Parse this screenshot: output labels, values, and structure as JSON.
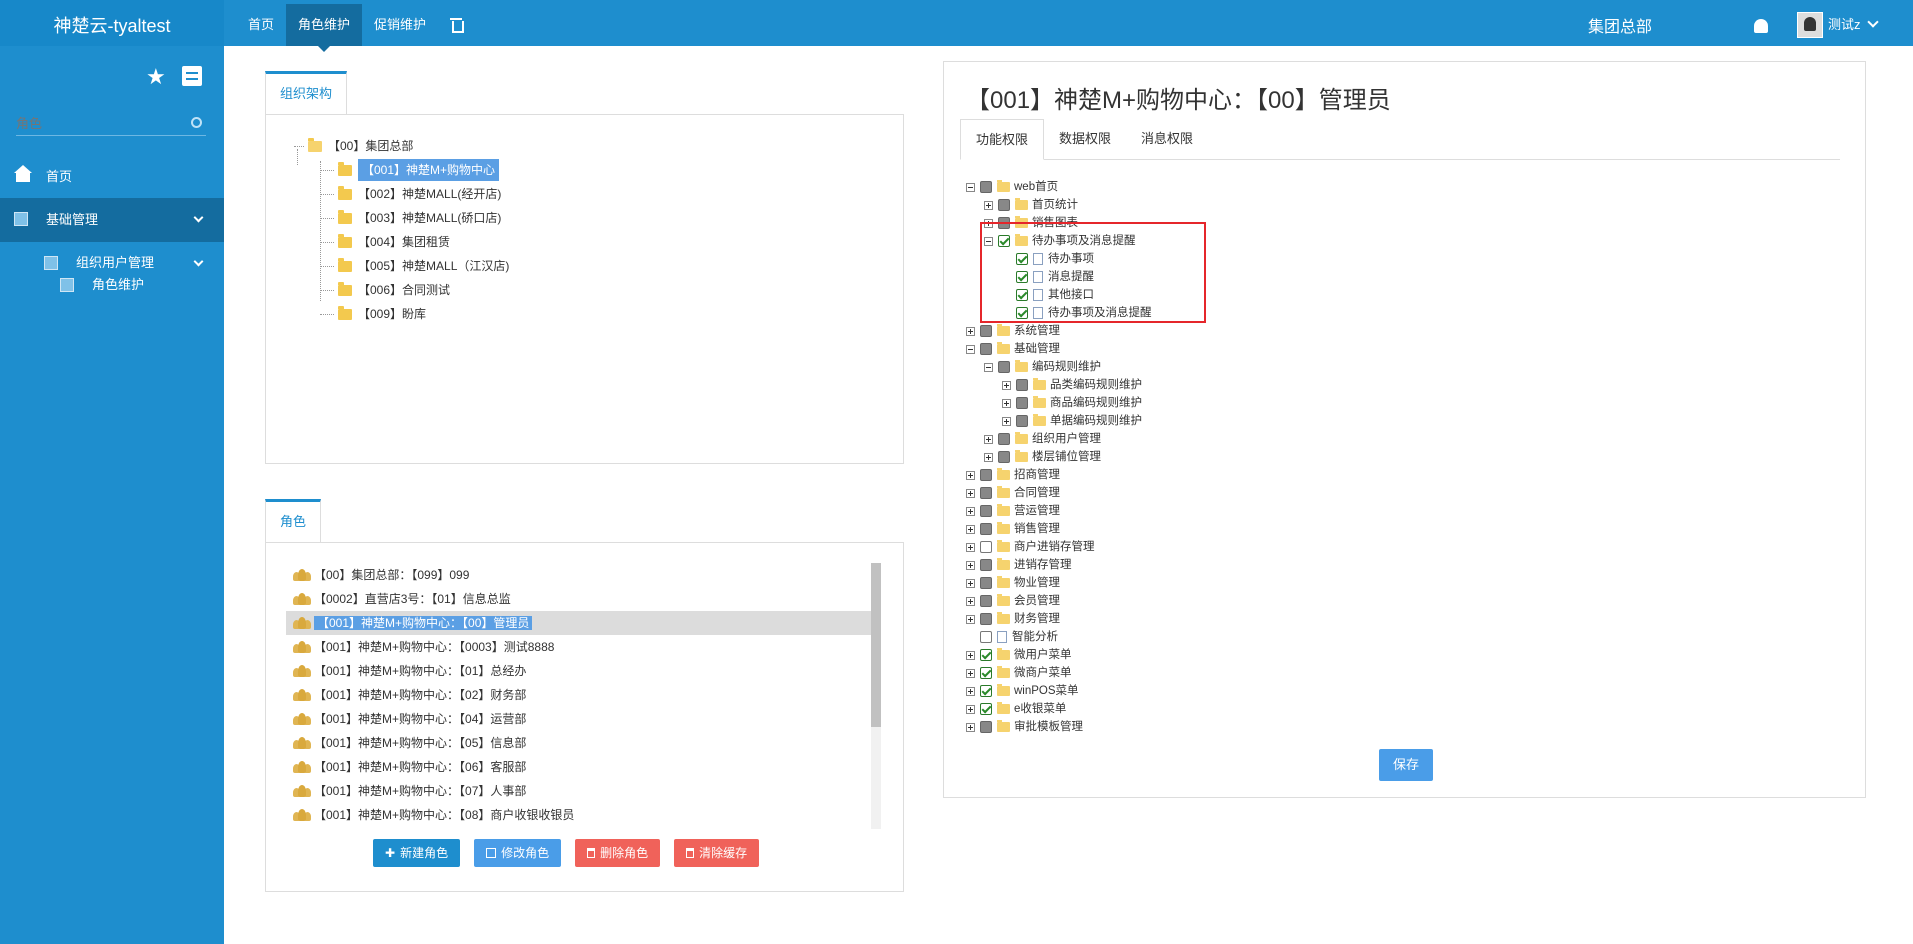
{
  "brand": "神楚云-tyaltest",
  "nav": {
    "items": [
      "首页",
      "角色维护",
      "促销维护"
    ],
    "org_title": "集团总部",
    "user": "测试z"
  },
  "sidebar": {
    "search_placeholder": "角色",
    "home": "首页",
    "basic": "基础管理",
    "org_user": "组织用户管理",
    "role": "角色维护"
  },
  "org_tree": {
    "tab": "组织架构",
    "root": "【00】集团总部",
    "children": [
      "【001】神楚M+购物中心",
      "【002】神楚MALL(经开店)",
      "【003】神楚MALL(硚口店)",
      "【004】集团租赁",
      "【005】神楚MALL（江汉店)",
      "【006】合同测试",
      "【009】盼库"
    ]
  },
  "roles": {
    "tab": "角色",
    "items": [
      "【00】集团总部：【099】099",
      "【0002】直营店3号：【01】信息总监",
      "【001】神楚M+购物中心：【00】管理员",
      "【001】神楚M+购物中心：【0003】测试8888",
      "【001】神楚M+购物中心：【01】总经办",
      "【001】神楚M+购物中心：【02】财务部",
      "【001】神楚M+购物中心：【04】运营部",
      "【001】神楚M+购物中心：【05】信息部",
      "【001】神楚M+购物中心：【06】客服部",
      "【001】神楚M+购物中心：【07】人事部",
      "【001】神楚M+购物中心：【08】商户收银收银员"
    ],
    "buttons": {
      "new": "新建角色",
      "edit": "修改角色",
      "delete": "删除角色",
      "clear": "清除缓存"
    }
  },
  "permissions": {
    "title": "【001】神楚M+购物中心：【00】管理员",
    "tabs": [
      "功能权限",
      "数据权限",
      "消息权限"
    ],
    "tree": [
      "web首页",
      "首页统计",
      "销售图表",
      "待办事项及消息提醒",
      "待办事项",
      "消息提醒",
      "其他接口",
      "待办事项及消息提醒",
      "系统管理",
      "基础管理",
      "编码规则维护",
      "品类编码规则维护",
      "商品编码规则维护",
      "单据编码规则维护",
      "组织用户管理",
      "楼层铺位管理",
      "招商管理",
      "合同管理",
      "营运管理",
      "销售管理",
      "商户进销存管理",
      "进销存管理",
      "物业管理",
      "会员管理",
      "财务管理",
      "智能分析",
      "微用户菜单",
      "微商户菜单",
      "winPOS菜单",
      "e收银菜单",
      "审批模板管理"
    ],
    "save": "保存"
  }
}
